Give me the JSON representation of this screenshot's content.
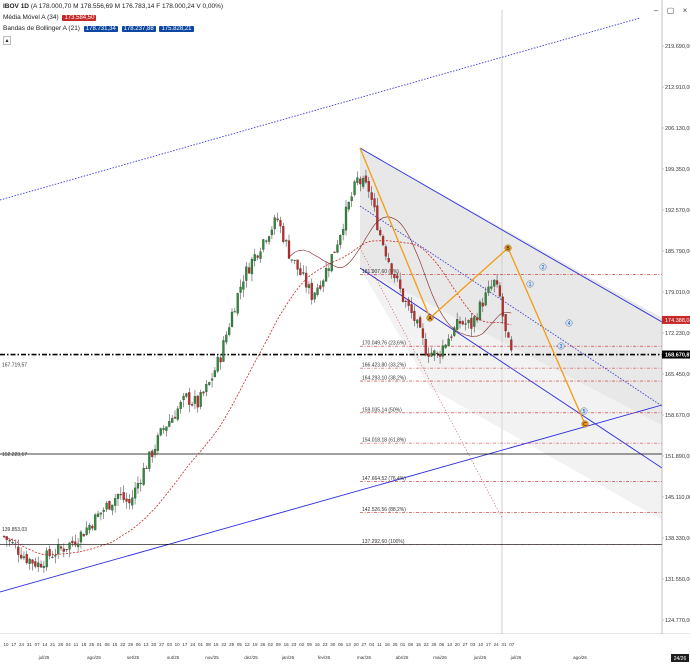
{
  "header": {
    "symbol": "IBOV 1D",
    "ohlc": "(A 178.000,70 M 178.556,69 M 176.783,14 F 178.000,24 V 0,00%)",
    "ma_label": "Média Móvel A (34)",
    "ma_value": "173.584,50",
    "bb_label": "Bandas de Bollinger A (21)",
    "bb_values": [
      "178.731,34",
      "178.237,88",
      "175.828,21"
    ],
    "colors": {
      "ma_badge": "#c62828",
      "bb_badge": "#0d47a1"
    }
  },
  "toolbar_icons": [
    "min-icon",
    "restore-icon",
    "close-icon"
  ],
  "axis": {
    "price_labels": [
      "219.690,00",
      "212.910,00",
      "206.130,00",
      "199.350,00",
      "192.570,00",
      "185.790,00",
      "179.010,00",
      "172.230,00",
      "165.450,00",
      "158.670,00",
      "151.890,00",
      "145.110,00",
      "138.330,00",
      "131.550,00",
      "124.770,00"
    ],
    "current_price_tag": "168.670,87",
    "ma_price_tag": "174.388,04",
    "date_ticks": [
      "10",
      "17",
      "24",
      "31",
      "07",
      "14",
      "21",
      "28",
      "04",
      "11",
      "18",
      "25",
      "01",
      "08",
      "15",
      "22",
      "29",
      "06",
      "13",
      "20",
      "27",
      "03",
      "10",
      "17",
      "24",
      "01",
      "08",
      "15",
      "22",
      "29",
      "05",
      "12",
      "19",
      "26",
      "02",
      "09",
      "16",
      "23",
      "02",
      "09",
      "16",
      "23",
      "30",
      "06",
      "13",
      "20",
      "27",
      "04",
      "11",
      "18",
      "25",
      "01",
      "08",
      "15",
      "22",
      "29",
      "06",
      "13",
      "20",
      "27",
      "03",
      "10",
      "17",
      "24",
      "31",
      "07"
    ],
    "month_labels": [
      "jul/25",
      "ago/25",
      "set/25",
      "out/25",
      "nov/25",
      "dez/25",
      "jan/26",
      "fev/26",
      "mar/26",
      "abr/26",
      "mai/26",
      "jun/26",
      "jul/26",
      "ago/26"
    ],
    "crosshair_label": "24/26"
  },
  "left_labels": [
    "167.719,57",
    "152.223,17",
    "139.853,03"
  ],
  "fibonacci": [
    {
      "label": "181.907,60 (0%)",
      "price": 181.9
    },
    {
      "label": "170.049,76 (23,6%)",
      "price": 170.05
    },
    {
      "label": "166.423,80 (33,2%)",
      "price": 166.42
    },
    {
      "label": "164.293,10 (38,2%)",
      "price": 164.29
    },
    {
      "label": "159.035,14 (50%)",
      "price": 159.04
    },
    {
      "label": "154.018,18 (61,8%)",
      "price": 154.02
    },
    {
      "label": "147.664,52 (76,4%)",
      "price": 147.66
    },
    {
      "label": "142.526,56 (88,2%)",
      "price": 142.53
    },
    {
      "label": "137.292,60 (100%)",
      "price": 137.29
    }
  ],
  "wave_labels": [
    "A",
    "B",
    "C",
    "1",
    "2",
    "3",
    "4",
    "5"
  ],
  "chart_data": {
    "type": "candlestick",
    "title": "IBOV 1D",
    "ylim": [
      124.77,
      222.0
    ],
    "y_unit": "thousand points",
    "price_path": [
      {
        "x": 0,
        "y": 138.6
      },
      {
        "x": 4,
        "y": 136.8
      },
      {
        "x": 8,
        "y": 135.0
      },
      {
        "x": 12,
        "y": 134.0
      },
      {
        "x": 16,
        "y": 135.5
      },
      {
        "x": 20,
        "y": 136.5
      },
      {
        "x": 24,
        "y": 137.6
      },
      {
        "x": 28,
        "y": 139.4
      },
      {
        "x": 32,
        "y": 141.5
      },
      {
        "x": 36,
        "y": 143.6
      },
      {
        "x": 40,
        "y": 145.5
      },
      {
        "x": 44,
        "y": 144.0
      },
      {
        "x": 48,
        "y": 148.5
      },
      {
        "x": 52,
        "y": 152.5
      },
      {
        "x": 56,
        "y": 156.5
      },
      {
        "x": 60,
        "y": 159.0
      },
      {
        "x": 64,
        "y": 161.5
      },
      {
        "x": 68,
        "y": 160.5
      },
      {
        "x": 72,
        "y": 163.8
      },
      {
        "x": 76,
        "y": 168.5
      },
      {
        "x": 80,
        "y": 175.5
      },
      {
        "x": 84,
        "y": 181.5
      },
      {
        "x": 88,
        "y": 185.0
      },
      {
        "x": 92,
        "y": 188.5
      },
      {
        "x": 96,
        "y": 191.0
      },
      {
        "x": 100,
        "y": 185.5
      },
      {
        "x": 104,
        "y": 182.0
      },
      {
        "x": 108,
        "y": 178.5
      },
      {
        "x": 112,
        "y": 181.5
      },
      {
        "x": 116,
        "y": 186.0
      },
      {
        "x": 120,
        "y": 192.0
      },
      {
        "x": 124,
        "y": 197.5
      },
      {
        "x": 128,
        "y": 196.0
      },
      {
        "x": 132,
        "y": 188.5
      },
      {
        "x": 136,
        "y": 183.0
      },
      {
        "x": 140,
        "y": 178.0
      },
      {
        "x": 144,
        "y": 174.5
      },
      {
        "x": 148,
        "y": 169.5
      },
      {
        "x": 152,
        "y": 168.5
      },
      {
        "x": 156,
        "y": 171.5
      },
      {
        "x": 160,
        "y": 174.0
      },
      {
        "x": 164,
        "y": 173.5
      },
      {
        "x": 168,
        "y": 177.5
      },
      {
        "x": 172,
        "y": 180.5
      },
      {
        "x": 174,
        "y": 178.0
      },
      {
        "x": 176,
        "y": 172.0
      },
      {
        "x": 178,
        "y": 168.7
      }
    ],
    "series": [
      {
        "name": "Média Móvel A (34)",
        "color": "#c62828",
        "style": "dashed"
      },
      {
        "name": "Bandas de Bollinger A (21)",
        "color": "#7a1f1f",
        "style": "solid"
      }
    ],
    "wave_points": [
      {
        "label": "A",
        "price": 169.0
      },
      {
        "label": "B",
        "price": 181.9
      },
      {
        "label": "C",
        "price": 152.5
      }
    ],
    "horizontal_levels": [
      {
        "price": 168.67,
        "style": "dash-dot",
        "color": "#000000"
      },
      {
        "price": 152.22,
        "style": "solid",
        "color": "#000000"
      },
      {
        "price": 137.29,
        "style": "solid",
        "color": "#000000"
      }
    ]
  }
}
